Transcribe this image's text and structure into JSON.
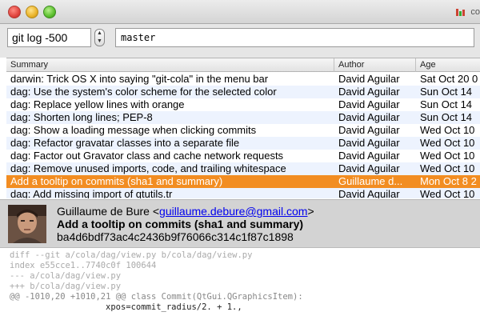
{
  "window": {
    "title_fragment": "co"
  },
  "toolbar": {
    "log_expression": "git log -500",
    "branch": "master"
  },
  "table": {
    "columns": [
      "Summary",
      "Author",
      "Age"
    ],
    "rows": [
      {
        "summary": "darwin: Trick OS X into saying \"git-cola\" in the menu bar",
        "author": "David Aguilar",
        "age": "Sat Oct 20 0",
        "selected": false
      },
      {
        "summary": "dag: Use the system's color scheme for the selected color",
        "author": "David Aguilar",
        "age": "Sun Oct 14",
        "selected": false
      },
      {
        "summary": "dag: Replace yellow lines with orange",
        "author": "David Aguilar",
        "age": "Sun Oct 14",
        "selected": false
      },
      {
        "summary": "dag: Shorten long lines; PEP-8",
        "author": "David Aguilar",
        "age": "Sun Oct 14",
        "selected": false
      },
      {
        "summary": "dag: Show a loading message when clicking commits",
        "author": "David Aguilar",
        "age": "Wed Oct 10",
        "selected": false
      },
      {
        "summary": "dag: Refactor gravatar classes into a separate file",
        "author": "David Aguilar",
        "age": "Wed Oct 10",
        "selected": false
      },
      {
        "summary": "dag: Factor out Gravator class and cache network requests",
        "author": "David Aguilar",
        "age": "Wed Oct 10",
        "selected": false
      },
      {
        "summary": "dag: Remove unused imports, code, and trailing whitespace",
        "author": "David Aguilar",
        "age": "Wed Oct 10",
        "selected": false
      },
      {
        "summary": "Add a tooltip on commits (sha1 and summary)",
        "author": "Guillaume d...",
        "age": "Mon Oct 8 2",
        "selected": true
      },
      {
        "summary": "dag: Add missing import of qtutils.tr",
        "author": "David Aguilar",
        "age": "Wed Oct 10",
        "selected": false
      }
    ]
  },
  "commit": {
    "author_name": "Guillaume de Bure",
    "email_open": "<",
    "email": "guillaume.debure@gmail.com",
    "email_close": ">",
    "subject": "Add a tooltip on commits (sha1 and summary)",
    "sha1": "ba4d6bdf73ac4c2436b9f76066c314c1f87c1898"
  },
  "diff": {
    "header_lines": [
      "diff --git a/cola/dag/view.py b/cola/dag/view.py",
      "index e55cce1..7740c0f 100644",
      "--- a/cola/dag/view.py",
      "+++ b/cola/dag/view.py"
    ],
    "hunk": "@@ -1010,20 +1010,21 @@ class Commit(QtGui.QGraphicsItem):",
    "code_line": "xpos=commit_radius/2. + 1.,"
  },
  "colors": {
    "selected_row": "#f28d22",
    "alt_row": "#edf3fe",
    "link": "#0000ee"
  }
}
